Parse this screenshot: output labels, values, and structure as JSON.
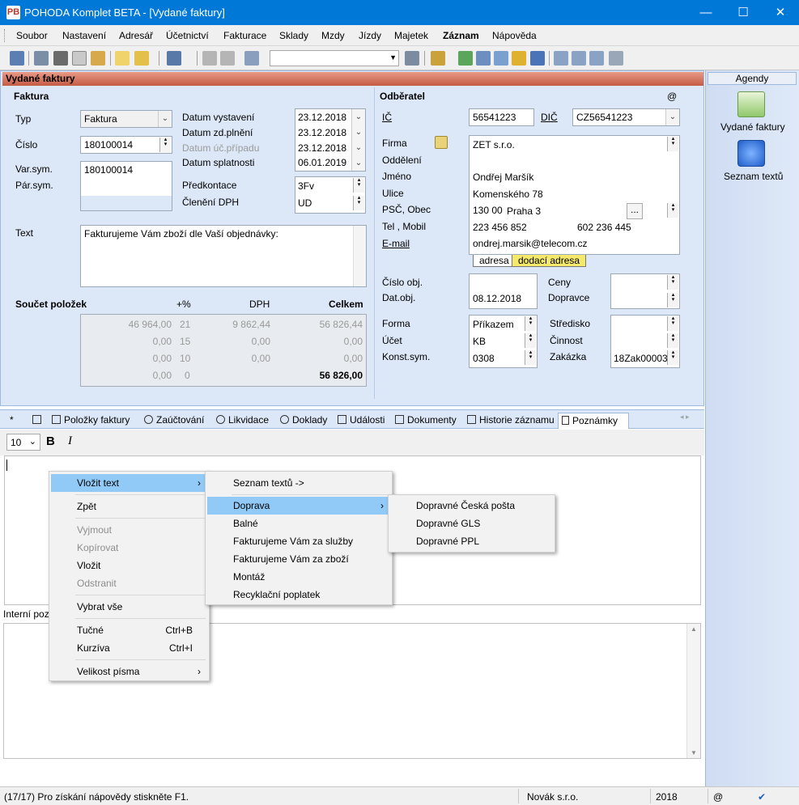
{
  "window": {
    "title": "POHODA Komplet BETA - [Vydané faktury]",
    "minimize": "—",
    "maximize": "☐",
    "close": "✕",
    "app_icon": "PB"
  },
  "menu": [
    "Soubor",
    "Nastavení",
    "Adresář",
    "Účetnictví",
    "Fakturace",
    "Sklady",
    "Mzdy",
    "Jízdy",
    "Majetek",
    "Záznam",
    "Nápověda"
  ],
  "pane_title": "Vydané faktury",
  "faktura": {
    "section": "Faktura",
    "typ_label": "Typ",
    "typ_value": "Faktura",
    "cislo_label": "Číslo",
    "cislo_value": "180100014",
    "varsym_label": "Var.sym.",
    "parsym_label": "Pár.sym.",
    "varsym_value": "180100014",
    "datum_vystaveni_label": "Datum vystavení",
    "datum_vystaveni": "23.12.2018",
    "datum_zdpl_label": "Datum zd.plnění",
    "datum_zdpl": "23.12.2018",
    "datum_uc_label": "Datum úč.případu",
    "datum_uc": "23.12.2018",
    "datum_spl_label": "Datum splatnosti",
    "datum_spl": "06.01.2019",
    "predkontace_label": "Předkontace",
    "predkontace": "3Fv",
    "cleneni_label": "Členění DPH",
    "cleneni": "UD",
    "text_label": "Text",
    "text_value": "Fakturujeme Vám zboží dle Vaší objednávky:"
  },
  "soucet": {
    "title": "Součet položek",
    "col_pct": "+%",
    "col_dph": "DPH",
    "col_celkem": "Celkem",
    "rows": [
      {
        "base": "46 964,00",
        "pct": "21",
        "dph": "9 862,44",
        "total": "56 826,44"
      },
      {
        "base": "0,00",
        "pct": "15",
        "dph": "0,00",
        "total": "0,00"
      },
      {
        "base": "0,00",
        "pct": "10",
        "dph": "0,00",
        "total": "0,00"
      },
      {
        "base": "0,00",
        "pct": "0",
        "dph": "",
        "total": "56 826,00"
      }
    ]
  },
  "odberatel": {
    "section": "Odběratel",
    "at": "@",
    "ic_label": "IČ",
    "ic": "56541223",
    "dic_label": "DIČ",
    "dic": "CZ56541223",
    "firma_label": "Firma",
    "firma": "ZET s.r.o.",
    "oddeleni_label": "Oddělení",
    "jmeno_label": "Jméno",
    "jmeno": "Ondřej Maršík",
    "ulice_label": "Ulice",
    "ulice": "Komenského 78",
    "psc_label": "PSČ, Obec",
    "psc": "130 00",
    "obec": "Praha 3",
    "tel_label": "Tel , Mobil",
    "tel": "223 456 852",
    "mobil": "602 236 445",
    "email_label": "E-mail",
    "email": "ondrej.marsik@telecom.cz",
    "tab_adresa": "adresa",
    "tab_dodaci": "dodací adresa",
    "cislo_obj_label": "Číslo obj.",
    "dat_obj_label": "Dat.obj.",
    "dat_obj": "08.12.2018",
    "ceny_label": "Ceny",
    "dopravce_label": "Dopravce",
    "forma_label": "Forma",
    "forma": "Příkazem",
    "ucet_label": "Účet",
    "ucet": "KB",
    "konst_label": "Konst.sym.",
    "konst": "0308",
    "stredisko_label": "Středisko",
    "cinnost_label": "Činnost",
    "zakazka_label": "Zakázka",
    "zakazka": "18Zak00003"
  },
  "agendy": {
    "title": "Agendy",
    "items": [
      "Vydané faktury",
      "Seznam textů"
    ]
  },
  "tabs": [
    "*",
    "Položky faktury",
    "Zaúčtování",
    "Likvidace",
    "Doklady",
    "Události",
    "Dokumenty",
    "Historie záznamu",
    "Poznámky"
  ],
  "format": {
    "size": "10",
    "bold": "B",
    "italic": "I"
  },
  "interni_label": "Interní poz",
  "context_menu": {
    "items": [
      {
        "label": "Vložit text",
        "state": "highlight",
        "arrow": "›"
      },
      {
        "label": "Zpět"
      },
      {
        "label": "Vyjmout",
        "state": "disabled"
      },
      {
        "label": "Kopírovat",
        "state": "disabled"
      },
      {
        "label": "Vložit"
      },
      {
        "label": "Odstranit",
        "state": "disabled"
      },
      {
        "label": "Vybrat vše"
      },
      {
        "label": "Tučné",
        "shortcut": "Ctrl+B"
      },
      {
        "label": "Kurzíva",
        "shortcut": "Ctrl+I"
      },
      {
        "label": "Velikost písma",
        "arrow": "›"
      }
    ]
  },
  "submenu1": {
    "items": [
      {
        "label": "Seznam textů ->"
      },
      {
        "label": "Doprava",
        "state": "highlight",
        "arrow": "›"
      },
      {
        "label": "Balné"
      },
      {
        "label": "Fakturujeme Vám za služby"
      },
      {
        "label": "Fakturujeme Vám za zboží"
      },
      {
        "label": "Montáž"
      },
      {
        "label": "Recyklační poplatek"
      }
    ]
  },
  "submenu2": {
    "items": [
      {
        "label": "Dopravné Česká pošta"
      },
      {
        "label": "Dopravné GLS"
      },
      {
        "label": "Dopravné PPL"
      }
    ]
  },
  "status": {
    "text": "(17/17) Pro získání nápovědy stiskněte F1.",
    "company": "Novák s.r.o.",
    "year": "2018",
    "at": "@",
    "check": "✔"
  }
}
